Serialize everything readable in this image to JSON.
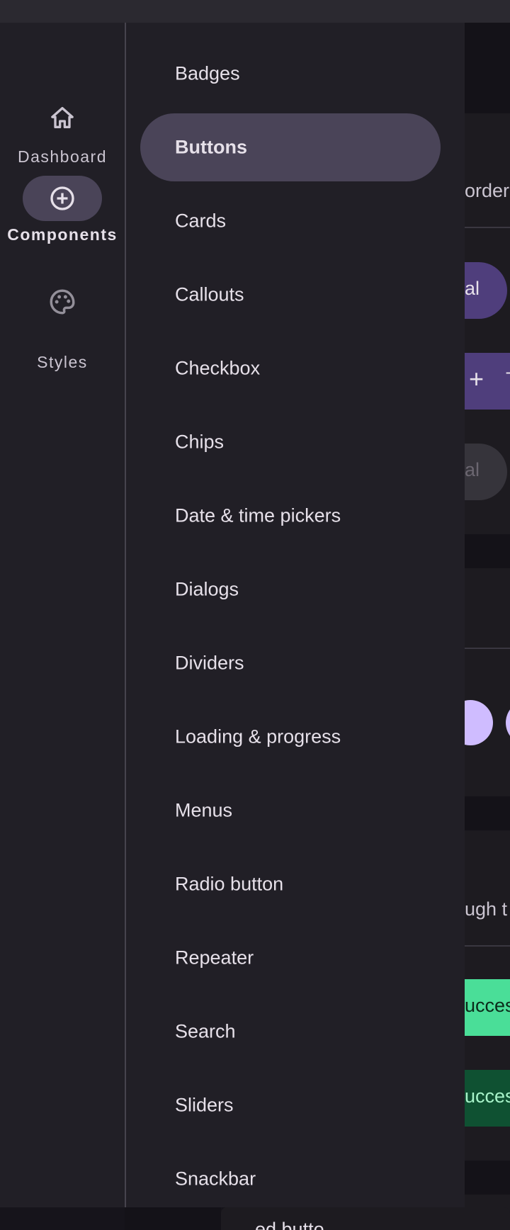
{
  "rail": {
    "items": [
      {
        "label": "Dashboard",
        "icon": "home-icon"
      },
      {
        "label": "Components",
        "icon": "add-circle-icon",
        "active": true
      },
      {
        "label": "Styles",
        "icon": "palette-icon"
      }
    ]
  },
  "drawer": {
    "items": [
      {
        "label": "Badges"
      },
      {
        "label": "Buttons",
        "selected": true
      },
      {
        "label": "Cards"
      },
      {
        "label": "Callouts"
      },
      {
        "label": "Checkbox"
      },
      {
        "label": "Chips"
      },
      {
        "label": "Date & time pickers"
      },
      {
        "label": "Dialogs"
      },
      {
        "label": "Dividers"
      },
      {
        "label": "Loading & progress"
      },
      {
        "label": "Menus"
      },
      {
        "label": "Radio button"
      },
      {
        "label": "Repeater"
      },
      {
        "label": "Search"
      },
      {
        "label": "Sliders"
      },
      {
        "label": "Snackbar"
      }
    ]
  },
  "content": {
    "peek_1": "orderl",
    "peek_2": "al",
    "peek_3": "+",
    "peek_4": "T",
    "peek_5": "al",
    "peek_6": "ugh t",
    "peek_7": "ucces",
    "peek_8": "ucces",
    "bottom_text": "ed butto"
  },
  "colors": {
    "accent": "#4a4458",
    "primary_button": "#4f3e7c",
    "success_light": "#4ade98",
    "success_dark": "#0f5132",
    "fab": "#cfbcff"
  }
}
